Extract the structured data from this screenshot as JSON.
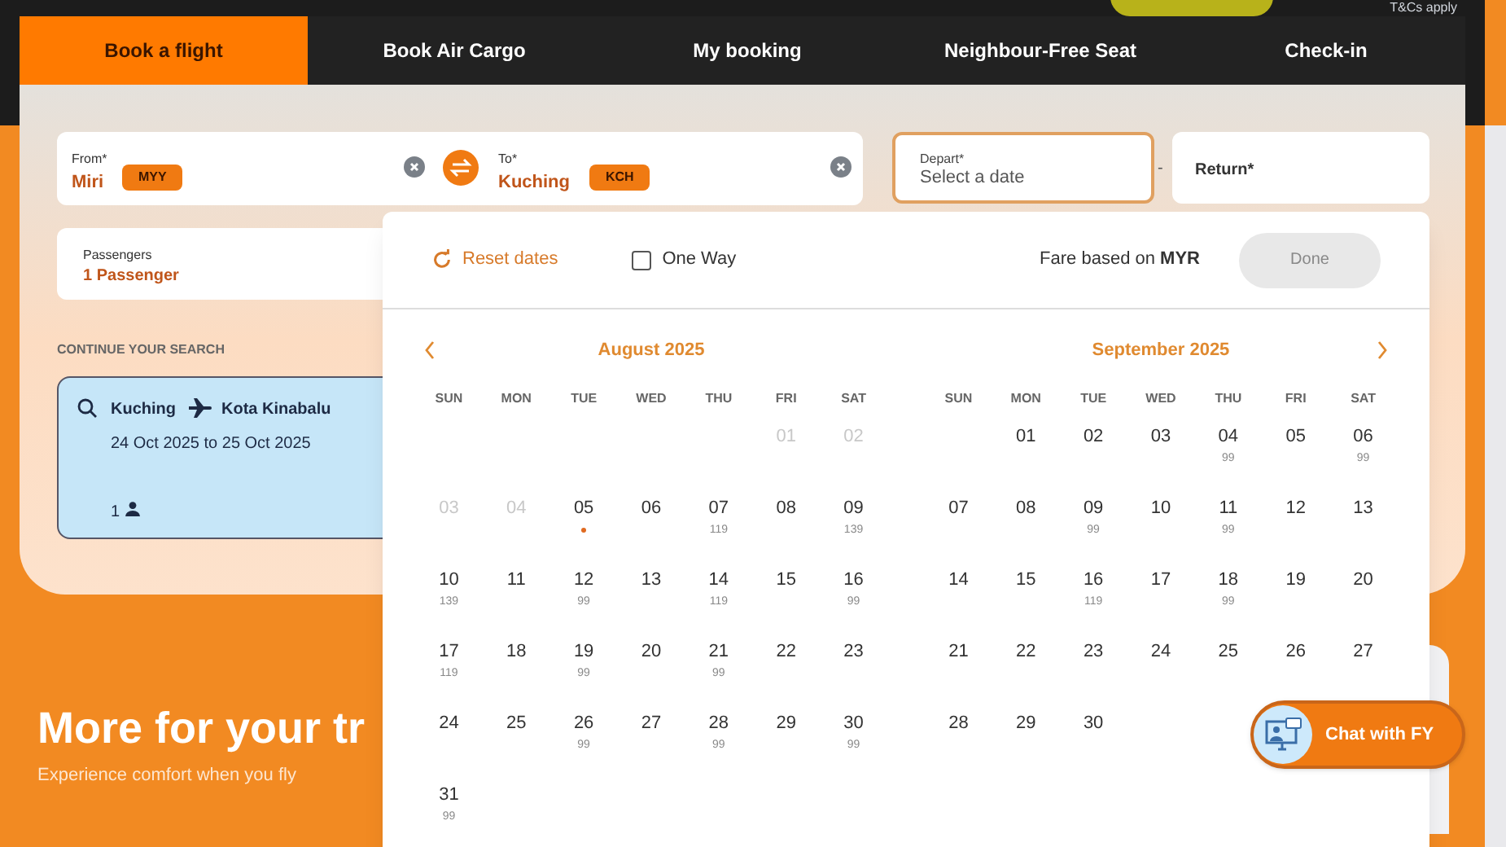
{
  "top_note": "T&Cs apply",
  "tabs": [
    {
      "label": "Book a flight",
      "selected": true
    },
    {
      "label": "Book Air Cargo",
      "selected": false
    },
    {
      "label": "My booking",
      "selected": false
    },
    {
      "label": "Neighbour-Free Seat",
      "selected": false
    },
    {
      "label": "Check-in",
      "selected": false
    }
  ],
  "from": {
    "label": "From*",
    "city": "Miri",
    "code": "MYY"
  },
  "to": {
    "label": "To*",
    "city": "Kuching",
    "code": "KCH"
  },
  "depart": {
    "label": "Depart*",
    "placeholder": "Select a date"
  },
  "separator": "-",
  "return": {
    "label": "Return*"
  },
  "passengers": {
    "label": "Passengers",
    "value": "1 Passenger"
  },
  "continue_search": {
    "heading": "CONTINUE YOUR SEARCH",
    "origin": "Kuching",
    "destination": "Kota Kinabalu",
    "dates": "24 Oct 2025 to 25 Oct 2025",
    "pax": "1"
  },
  "promo": {
    "title": "More for your tr",
    "subtitle": "Experience comfort when you fly"
  },
  "calendar": {
    "reset": "Reset dates",
    "one_way": {
      "label": "One Way",
      "checked": false
    },
    "fare_prefix": "Fare based on ",
    "currency": "MYR",
    "done": {
      "label": "Done",
      "disabled": true
    },
    "months": [
      {
        "title": "August 2025",
        "weekdays": [
          "SUN",
          "MON",
          "TUE",
          "WED",
          "THU",
          "FRI",
          "SAT"
        ],
        "weeks": [
          {
            "starts_mid_week": true,
            "days": [
              {
                "day": "01",
                "disabled": true
              },
              {
                "day": "02",
                "disabled": true
              }
            ]
          },
          [
            {
              "day": "03",
              "disabled": true
            },
            {
              "day": "04",
              "disabled": true
            },
            {
              "day": "05",
              "disabled": false,
              "today": true
            },
            {
              "day": "06",
              "disabled": false
            },
            {
              "day": "07",
              "disabled": false,
              "price": "119"
            },
            {
              "day": "08",
              "disabled": false
            },
            {
              "day": "09",
              "disabled": false,
              "price": "139"
            }
          ],
          [
            {
              "day": "10",
              "disabled": false,
              "price": "139"
            },
            {
              "day": "11",
              "disabled": false
            },
            {
              "day": "12",
              "disabled": false,
              "price": "99"
            },
            {
              "day": "13",
              "disabled": false
            },
            {
              "day": "14",
              "disabled": false,
              "price": "119"
            },
            {
              "day": "15",
              "disabled": false
            },
            {
              "day": "16",
              "disabled": false,
              "price": "99"
            }
          ],
          [
            {
              "day": "17",
              "disabled": false,
              "price": "119"
            },
            {
              "day": "18",
              "disabled": false
            },
            {
              "day": "19",
              "disabled": false,
              "price": "99"
            },
            {
              "day": "20",
              "disabled": false
            },
            {
              "day": "21",
              "disabled": false,
              "price": "99"
            },
            {
              "day": "22",
              "disabled": false
            },
            {
              "day": "23",
              "disabled": false
            }
          ],
          [
            {
              "day": "24",
              "disabled": false
            },
            {
              "day": "25",
              "disabled": false
            },
            {
              "day": "26",
              "disabled": false,
              "price": "99"
            },
            {
              "day": "27",
              "disabled": false
            },
            {
              "day": "28",
              "disabled": false,
              "price": "99"
            },
            {
              "day": "29",
              "disabled": false
            },
            {
              "day": "30",
              "disabled": false,
              "price": "99"
            }
          ],
          [
            {
              "day": "31",
              "disabled": false,
              "price": "99"
            }
          ]
        ]
      },
      {
        "title": "September 2025",
        "weekdays": [
          "SUN",
          "MON",
          "TUE",
          "WED",
          "THU",
          "FRI",
          "SAT"
        ],
        "weeks": [
          {
            "starts_mid_week": true,
            "days": [
              {
                "day": "01",
                "disabled": false
              },
              {
                "day": "02",
                "disabled": false
              },
              {
                "day": "03",
                "disabled": false
              },
              {
                "day": "04",
                "disabled": false,
                "price": "99"
              },
              {
                "day": "05",
                "disabled": false
              },
              {
                "day": "06",
                "disabled": false,
                "price": "99"
              }
            ]
          },
          [
            {
              "day": "07",
              "disabled": false
            },
            {
              "day": "08",
              "disabled": false
            },
            {
              "day": "09",
              "disabled": false,
              "price": "99"
            },
            {
              "day": "10",
              "disabled": false
            },
            {
              "day": "11",
              "disabled": false,
              "price": "99"
            },
            {
              "day": "12",
              "disabled": false
            },
            {
              "day": "13",
              "disabled": false
            }
          ],
          [
            {
              "day": "14",
              "disabled": false
            },
            {
              "day": "15",
              "disabled": false
            },
            {
              "day": "16",
              "disabled": false,
              "price": "119"
            },
            {
              "day": "17",
              "disabled": false
            },
            {
              "day": "18",
              "disabled": false,
              "price": "99"
            },
            {
              "day": "19",
              "disabled": false
            },
            {
              "day": "20",
              "disabled": false
            }
          ],
          [
            {
              "day": "21",
              "disabled": false
            },
            {
              "day": "22",
              "disabled": false
            },
            {
              "day": "23",
              "disabled": false
            },
            {
              "day": "24",
              "disabled": false
            },
            {
              "day": "25",
              "disabled": false
            },
            {
              "day": "26",
              "disabled": false
            },
            {
              "day": "27",
              "disabled": false
            }
          ],
          [
            {
              "day": "28",
              "disabled": false
            },
            {
              "day": "29",
              "disabled": false
            },
            {
              "day": "30",
              "disabled": false
            }
          ]
        ]
      }
    ]
  },
  "chat": {
    "label": "Chat with FY"
  }
}
